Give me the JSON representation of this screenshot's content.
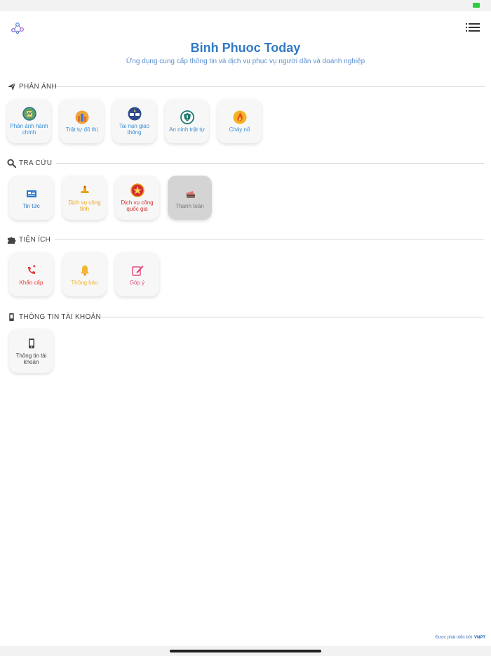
{
  "header": {
    "title": "Binh Phuoc Today",
    "subtitle": "Ứng dụng cung cấp thông tin và dịch vụ phục vụ người dân và doanh nghiệp"
  },
  "sections": [
    {
      "title": "PHẢN ÁNH",
      "icon": "paper-plane-icon",
      "items": [
        {
          "label": "Phản ánh hành chính",
          "icon": "admin-feedback-icon",
          "color": "#3a8fd6"
        },
        {
          "label": "Trật tự đô thị",
          "icon": "city-order-icon",
          "color": "#3a8fd6"
        },
        {
          "label": "Tai nạn giao thông",
          "icon": "traffic-accident-icon",
          "color": "#3a8fd6"
        },
        {
          "label": "An ninh trật tự",
          "icon": "security-shield-icon",
          "color": "#3a8fd6"
        },
        {
          "label": "Cháy nổ",
          "icon": "fire-icon",
          "color": "#3a8fd6"
        }
      ]
    },
    {
      "title": "TRA CỨU",
      "icon": "search-icon",
      "items": [
        {
          "label": "Tin tức",
          "icon": "news-icon",
          "color": "#2a73c8"
        },
        {
          "label": "Dịch vụ công tỉnh",
          "icon": "provincial-service-icon",
          "color": "#e8a317"
        },
        {
          "label": "Dịch vụ công quốc gia",
          "icon": "national-emblem-icon",
          "color": "#d32f2f"
        },
        {
          "label": "Thanh toán",
          "icon": "payment-icon",
          "color": "#777777"
        }
      ]
    },
    {
      "title": "TIỆN ÍCH",
      "icon": "puzzle-icon",
      "items": [
        {
          "label": "Khẩn cấp",
          "icon": "emergency-phone-icon",
          "color": "#e53935"
        },
        {
          "label": "Thông báo",
          "icon": "bell-icon",
          "color": "#f2b632"
        },
        {
          "label": "Góp ý",
          "icon": "feedback-pen-icon",
          "color": "#e04a7e"
        }
      ]
    },
    {
      "title": "THÔNG TIN TÀI KHOẢN",
      "icon": "phone-device-icon",
      "items": [
        {
          "label": "Thông tin tài khoản",
          "icon": "account-device-icon",
          "color": "#444444"
        }
      ]
    }
  ],
  "footer": {
    "credit": "Được phát triển bởi",
    "brand": "VNPT"
  }
}
